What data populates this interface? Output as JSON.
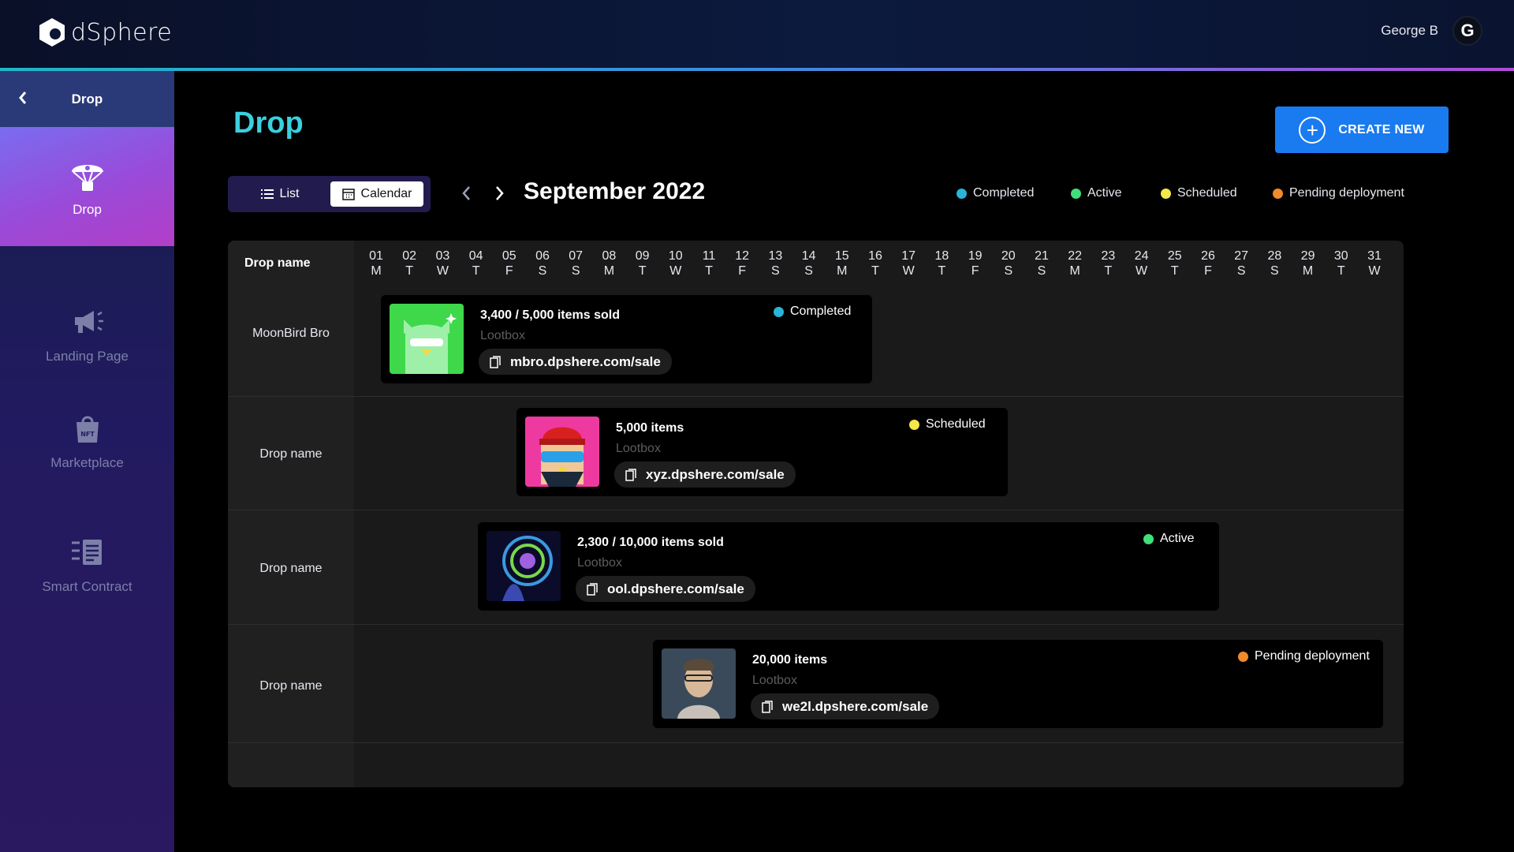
{
  "header": {
    "brand": "dSphere",
    "user_name": "George B",
    "avatar_letter": "G"
  },
  "sidebar": {
    "header_title": "Drop",
    "items": [
      {
        "label": "Drop",
        "icon": "parachute-icon",
        "active": true
      },
      {
        "label": "Landing Page",
        "icon": "megaphone-icon"
      },
      {
        "label": "Marketplace",
        "icon": "nft-bag-icon"
      },
      {
        "label": "Smart Contract",
        "icon": "contract-list-icon"
      }
    ]
  },
  "main": {
    "title": "Drop",
    "create_label": "CREATE NEW",
    "view_toggle": {
      "list": "List",
      "calendar": "Calendar",
      "selected": "Calendar"
    },
    "month_label": "September 2022",
    "legend": [
      {
        "label": "Completed",
        "color": "#2ab4d8"
      },
      {
        "label": "Active",
        "color": "#3ee07a"
      },
      {
        "label": "Scheduled",
        "color": "#f2e84a"
      },
      {
        "label": "Pending deployment",
        "color": "#f08a2a"
      }
    ]
  },
  "calendar": {
    "name_header": "Drop name",
    "days": [
      {
        "d": "01",
        "w": "M"
      },
      {
        "d": "02",
        "w": "T"
      },
      {
        "d": "03",
        "w": "W"
      },
      {
        "d": "04",
        "w": "T"
      },
      {
        "d": "05",
        "w": "F"
      },
      {
        "d": "06",
        "w": "S"
      },
      {
        "d": "07",
        "w": "S"
      },
      {
        "d": "08",
        "w": "M"
      },
      {
        "d": "09",
        "w": "T"
      },
      {
        "d": "10",
        "w": "W"
      },
      {
        "d": "11",
        "w": "T"
      },
      {
        "d": "12",
        "w": "F"
      },
      {
        "d": "13",
        "w": "S"
      },
      {
        "d": "14",
        "w": "S"
      },
      {
        "d": "15",
        "w": "M"
      },
      {
        "d": "16",
        "w": "T"
      },
      {
        "d": "17",
        "w": "W"
      },
      {
        "d": "18",
        "w": "T"
      },
      {
        "d": "19",
        "w": "F"
      },
      {
        "d": "20",
        "w": "S"
      },
      {
        "d": "21",
        "w": "S"
      },
      {
        "d": "22",
        "w": "M"
      },
      {
        "d": "23",
        "w": "T"
      },
      {
        "d": "24",
        "w": "W"
      },
      {
        "d": "25",
        "w": "T"
      },
      {
        "d": "26",
        "w": "F"
      },
      {
        "d": "27",
        "w": "S"
      },
      {
        "d": "28",
        "w": "S"
      },
      {
        "d": "29",
        "w": "M"
      },
      {
        "d": "30",
        "w": "T"
      },
      {
        "d": "31",
        "w": "W"
      }
    ],
    "rows": [
      {
        "name": "MoonBird Bro",
        "title": "3,400 / 5,000 items sold",
        "type": "Lootbox",
        "link": "mbro.dpshere.com/sale",
        "status": "Completed",
        "status_color": "#2ab4d8"
      },
      {
        "name": "Drop name",
        "title": "5,000 items",
        "type": "Lootbox",
        "link": "xyz.dpshere.com/sale",
        "status": "Scheduled",
        "status_color": "#f2e84a"
      },
      {
        "name": "Drop name",
        "title": "2,300 / 10,000 items sold",
        "type": "Lootbox",
        "link": "ool.dpshere.com/sale",
        "status": "Active",
        "status_color": "#3ee07a"
      },
      {
        "name": "Drop name",
        "title": "20,000 items",
        "type": "Lootbox",
        "link": "we2l.dpshere.com/sale",
        "status": "Pending deployment",
        "status_color": "#f08a2a"
      }
    ]
  }
}
